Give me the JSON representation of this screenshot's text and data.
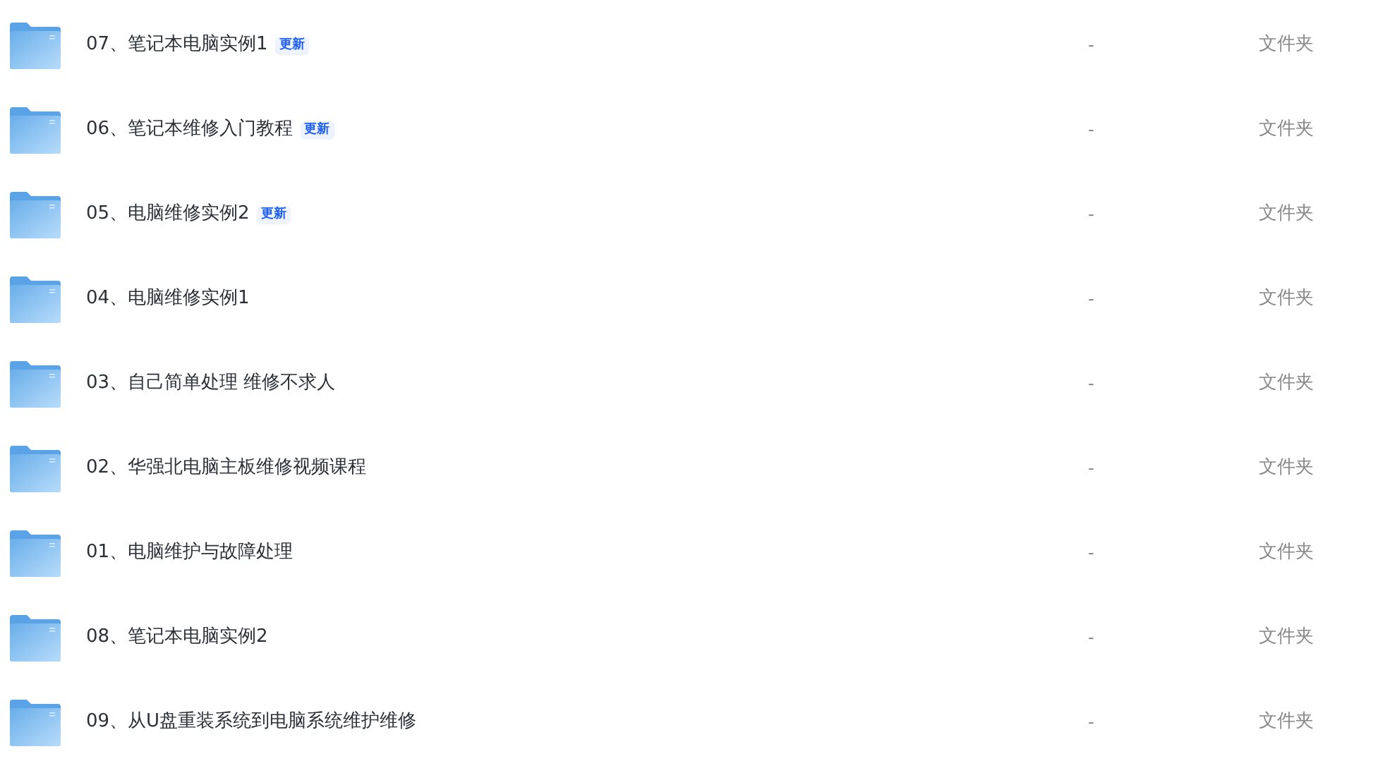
{
  "files": [
    {
      "name": "07、笔记本电脑实例1",
      "badge": "更新",
      "size": "-",
      "type": "文件夹"
    },
    {
      "name": "06、笔记本维修入门教程",
      "badge": "更新",
      "size": "-",
      "type": "文件夹"
    },
    {
      "name": "05、电脑维修实例2",
      "badge": "更新",
      "size": "-",
      "type": "文件夹"
    },
    {
      "name": "04、电脑维修实例1",
      "size": "-",
      "type": "文件夹"
    },
    {
      "name": "03、自己简单处理 维修不求人",
      "size": "-",
      "type": "文件夹"
    },
    {
      "name": "02、华强北电脑主板维修视频课程",
      "size": "-",
      "type": "文件夹"
    },
    {
      "name": "01、电脑维护与故障处理",
      "size": "-",
      "type": "文件夹"
    },
    {
      "name": "08、笔记本电脑实例2",
      "size": "-",
      "type": "文件夹"
    },
    {
      "name": "09、从U盘重装系统到电脑系统维护维修",
      "size": "-",
      "type": "文件夹"
    }
  ]
}
